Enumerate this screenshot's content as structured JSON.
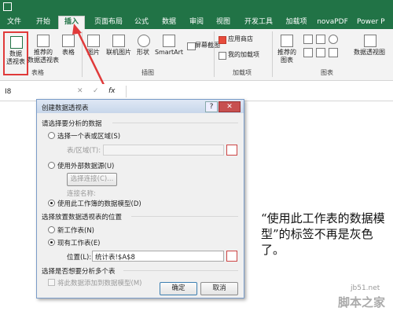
{
  "ribbon": {
    "tabs": [
      {
        "label": "文件"
      },
      {
        "label": "开始"
      },
      {
        "label": "插入"
      },
      {
        "label": "页面布局"
      },
      {
        "label": "公式"
      },
      {
        "label": "数据"
      },
      {
        "label": "审阅"
      },
      {
        "label": "视图"
      },
      {
        "label": "开发工具"
      },
      {
        "label": "加载项"
      },
      {
        "label": "novaPDF"
      },
      {
        "label": "Power P"
      }
    ],
    "active_tab": "插入",
    "buttons": {
      "pivot_line1": "数据",
      "pivot_line2": "透视表",
      "recommended_pivot_line1": "推荐的",
      "recommended_pivot_line2": "数据透视表",
      "table": "表格",
      "picture": "图片",
      "online_picture": "联机图片",
      "shapes": "形状",
      "smartart": "SmartArt",
      "screenshot": "屏幕截图",
      "store": "应用商店",
      "my_addins": "我的加载项",
      "recommended_charts_line1": "推荐的",
      "recommended_charts_line2": "图表",
      "pivot_chart": "数据透视图"
    },
    "groups": {
      "tables": "表格",
      "illustrations": "插图",
      "addins": "加载项",
      "charts": "图表"
    },
    "accent_color": "#217346",
    "highlight_color": "#e03a3a"
  },
  "formula_bar": {
    "cell_ref": "I8",
    "fx": "fx",
    "cancel": "✕",
    "confirm": "✓"
  },
  "dialog": {
    "title": "创建数据透视表",
    "help": "?",
    "close": "✕",
    "section1": "请选择要分析的数据",
    "opt_table_range": "选择一个表或区域(S)",
    "table_range_label": "表/区域(T):",
    "opt_external": "使用外部数据源(U)",
    "choose_connection": "选择连接(C)...",
    "connection_name": "连接名称:",
    "opt_data_model": "使用此工作簿的数据模型(D)",
    "section2": "选择放置数据透视表的位置",
    "opt_new_sheet": "新工作表(N)",
    "opt_existing_sheet": "现有工作表(E)",
    "location_label": "位置(L):",
    "location_value": "统计表!$A$8",
    "section3": "选择是否想要分析多个表",
    "add_to_model": "将此数据添加到数据模型(M)",
    "ok": "确定",
    "cancel": "取消"
  },
  "annotation": {
    "text": "“使用此工作表的数据模型”的标签不再是灰色了。"
  },
  "watermark": {
    "site": "jb51.net",
    "brand": "脚本之家"
  }
}
